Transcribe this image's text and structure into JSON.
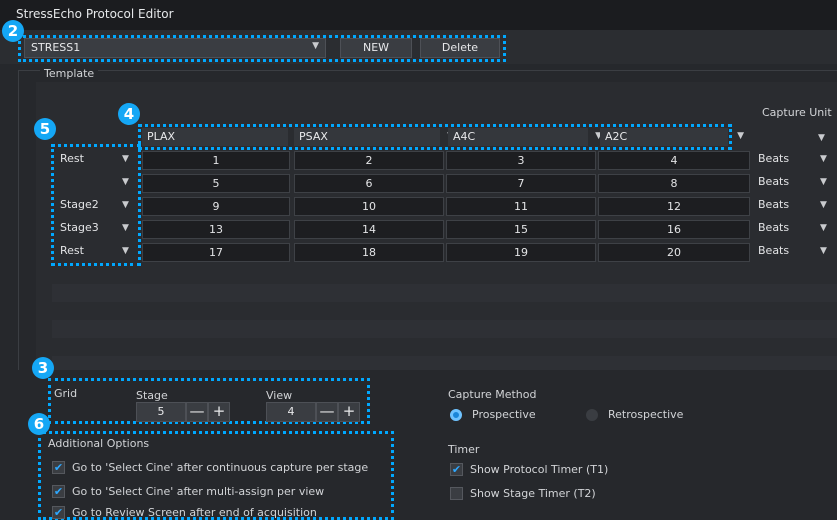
{
  "window": {
    "title": "StressEcho Protocol Editor"
  },
  "markers": [
    "2",
    "3",
    "4",
    "5",
    "6"
  ],
  "toolbar": {
    "protocol_value": "STRESS1",
    "new_label": "NEW",
    "delete_label": "Delete"
  },
  "template": {
    "label": "Template",
    "capture_unit_header": "Capture Unit",
    "views": [
      "PLAX",
      "PSAX",
      "A4C",
      "A2C"
    ],
    "stages": [
      "Rest",
      "",
      "Stage2",
      "Stage3",
      "Rest"
    ],
    "cells": [
      [
        "1",
        "2",
        "3",
        "4"
      ],
      [
        "5",
        "6",
        "7",
        "8"
      ],
      [
        "9",
        "10",
        "11",
        "12"
      ],
      [
        "13",
        "14",
        "15",
        "16"
      ],
      [
        "17",
        "18",
        "19",
        "20"
      ]
    ],
    "units": [
      "Beats",
      "Beats",
      "Beats",
      "Beats",
      "Beats"
    ]
  },
  "grid": {
    "label": "Grid",
    "stage_label": "Stage",
    "stage_value": "5",
    "view_label": "View",
    "view_value": "4",
    "minus": "—",
    "plus": "+"
  },
  "capture_method": {
    "label": "Capture Method",
    "options": [
      "Prospective",
      "Retrospective"
    ],
    "selected": "Prospective"
  },
  "timer": {
    "label": "Timer",
    "options": [
      {
        "label": "Show Protocol Timer (T1)",
        "checked": true
      },
      {
        "label": "Show Stage Timer (T2)",
        "checked": false
      }
    ]
  },
  "additional_options": {
    "label": "Additional Options",
    "options": [
      {
        "label": "Go to 'Select Cine' after continuous capture per stage",
        "checked": true
      },
      {
        "label": "Go to 'Select Cine' after multi-assign per view",
        "checked": true
      },
      {
        "label": "Go to Review Screen after end of acquisition",
        "checked": true
      }
    ]
  },
  "colors": {
    "accent": "#00a8ff",
    "marker": "#15a7f5",
    "background": "#26282c"
  }
}
